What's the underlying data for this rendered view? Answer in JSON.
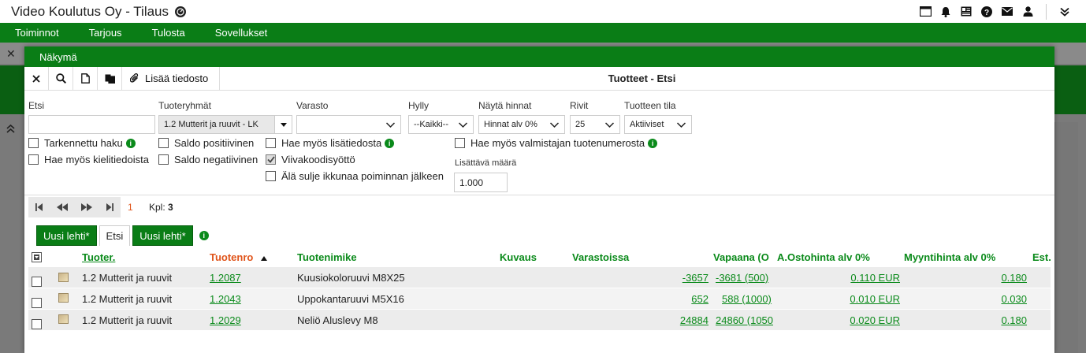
{
  "app": {
    "title": "Video Koulutus Oy - Tilaus",
    "title_icon": "dashboard-icon"
  },
  "header_icons": [
    "window-icon",
    "bell-icon",
    "news-icon",
    "help-icon",
    "mail-icon",
    "user-icon",
    "chevrons-down-icon"
  ],
  "menubar": {
    "items": [
      "Toiminnot",
      "Tarjous",
      "Tulosta",
      "Sovellukset"
    ]
  },
  "modal": {
    "title": "Näkymä",
    "toolbar": {
      "add_file_label": "Lisää tiedosto",
      "title": "Tuotteet - Etsi"
    },
    "form": {
      "search_label": "Etsi",
      "search_value": "",
      "groups_label": "Tuoteryhmät",
      "groups_value": "1.2 Mutterit ja ruuvit - LK",
      "warehouse_label": "Varasto",
      "warehouse_value": "",
      "shelf_label": "Hylly",
      "shelf_value": "--Kaikki--",
      "prices_label": "Näytä hinnat",
      "prices_value": "Hinnat alv 0%",
      "rows_label": "Rivit",
      "rows_value": "25",
      "status_label": "Tuotteen tila",
      "status_value": "Aktiiviset",
      "checkboxes": {
        "advanced_search": "Tarkennettu haku",
        "balance_positive": "Saldo positiivinen",
        "also_additional": "Hae myös lisätiedosta",
        "also_manufacturer": "Hae myös valmistajan tuotenumerosta",
        "also_language": "Hae myös kielitiedoista",
        "balance_negative": "Saldo negatiivinen",
        "barcode_input": "Viivakoodisyöttö",
        "keep_window_open": "Älä sulje ikkunaa poiminnan jälkeen"
      },
      "add_qty_label": "Lisättävä määrä",
      "add_qty_value": "1.000"
    },
    "pager": {
      "page": "1",
      "count_label": "Kpl:",
      "count_value": "3"
    },
    "tabs": {
      "new_sheet_1": "Uusi lehti*",
      "search": "Etsi",
      "new_sheet_2": "Uusi lehti*"
    },
    "table": {
      "columns": [
        "Tuoter.",
        "Tuotenro",
        "Tuotenimike",
        "Kuvaus",
        "Varastoissa",
        "Vapaana (O",
        "A.Ostohinta alv 0%",
        "Myyntihinta alv 0%",
        "Est."
      ],
      "rows": [
        {
          "group": "1.2 Mutterit ja ruuvit",
          "code": "1.2087",
          "name": "Kuusiokoloruuvi M8X25",
          "stock": "-3657",
          "free": "-3681 (500)",
          "purchase": "0.110 EUR",
          "sale": "0.180"
        },
        {
          "group": "1.2 Mutterit ja ruuvit",
          "code": "1.2043",
          "name": "Uppokantaruuvi M5X16",
          "stock": "652",
          "free": "588 (1000)",
          "purchase": "0.010 EUR",
          "sale": "0.030"
        },
        {
          "group": "1.2 Mutterit ja ruuvit",
          "code": "1.2029",
          "name": "Neliö Aluslevy M8",
          "stock": "24884",
          "free": "24860 (1050",
          "purchase": "0.020 EUR",
          "sale": "0.180"
        }
      ]
    }
  },
  "colors": {
    "brand_green": "#0a7d16",
    "link_green": "#0a8a1a",
    "sort_orange": "#e0541a"
  }
}
